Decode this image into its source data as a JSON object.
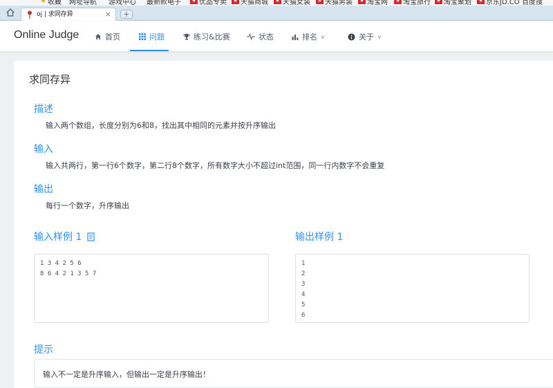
{
  "browser": {
    "bookmarks": [
      "收藏",
      "网址导航",
      "游戏中心",
      "最新款电子",
      "优品专卖",
      "天猫商城",
      "天猫女装",
      "天猫男装",
      "淘宝网",
      "淘宝旅行",
      "淘宝聚划",
      "京东JD.CO",
      "百度搜"
    ],
    "tab": {
      "title": "oj | 求同存异",
      "close": "×"
    },
    "newtab": "+"
  },
  "nav": {
    "brand": "Online Judge",
    "items": [
      {
        "label": "首页",
        "icon": "home-icon"
      },
      {
        "label": "问题",
        "icon": "grid-icon",
        "active": true
      },
      {
        "label": "练习&比赛",
        "icon": "trophy-icon"
      },
      {
        "label": "状态",
        "icon": "pulse-icon"
      },
      {
        "label": "排名",
        "icon": "bar-chart-icon"
      },
      {
        "label": "关于",
        "icon": "info-icon"
      }
    ],
    "accent": "#2d8cf0"
  },
  "problem": {
    "title": "求同存异",
    "description": {
      "heading": "描述",
      "text": "输入两个数组，长度分别为6和8，找出其中相同的元素并按升序输出"
    },
    "input": {
      "heading": "输入",
      "text": "输入共两行，第一行6个数字，第二行8个数字，所有数字大小不超过int范围，同一行内数字不会重复"
    },
    "output": {
      "heading": "输出",
      "text": "每行一个数字，升序输出"
    },
    "sample_input": {
      "heading": "输入样例 1",
      "lines": [
        "1 3 4 2 5 6",
        "8 6 4 2 1 3 5 7"
      ]
    },
    "sample_output": {
      "heading": "输出样例 1",
      "lines": [
        "1",
        "2",
        "3",
        "4",
        "5",
        "6"
      ]
    },
    "hint": {
      "heading": "提示",
      "text": "输入不一定是升序输入，但输出一定是升序输出！"
    }
  }
}
